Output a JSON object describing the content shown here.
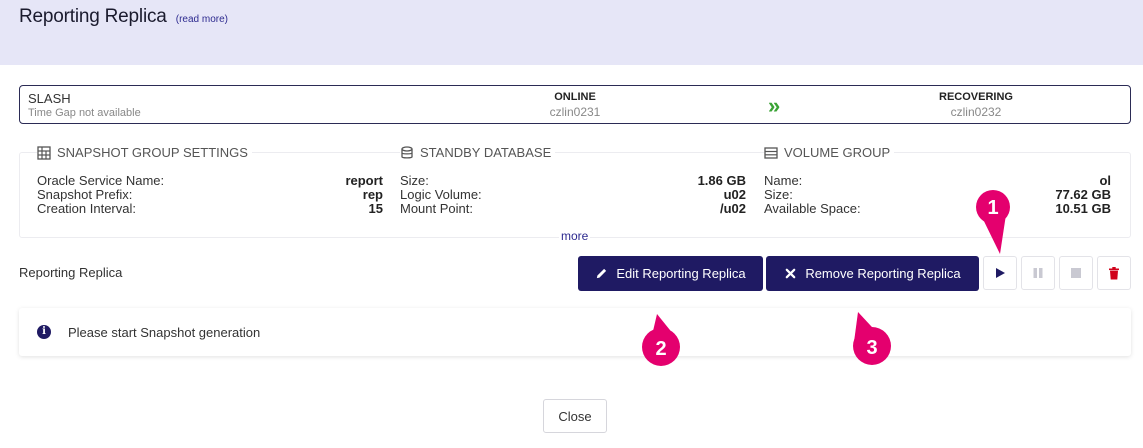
{
  "header": {
    "title": "Reporting Replica",
    "read_more": "(read more)"
  },
  "status": {
    "source_name": "SLASH",
    "time_gap": "Time Gap not available",
    "source_state": "ONLINE",
    "source_host": "czlin0231",
    "transfer_icon": "double-chevron-right-icon",
    "target_state": "RECOVERING",
    "target_host": "czlin0232"
  },
  "snapshot_group": {
    "heading": "SNAPSHOT GROUP SETTINGS",
    "icon": "table-grid-icon",
    "rows": [
      {
        "label": "Oracle Service Name:",
        "value": "report"
      },
      {
        "label": "Snapshot Prefix:",
        "value": "rep"
      },
      {
        "label": "Creation Interval:",
        "value": "15"
      }
    ]
  },
  "standby_db": {
    "heading": "STANDBY DATABASE",
    "icon": "database-icon",
    "rows": [
      {
        "label": "Size:",
        "value": "1.86 GB"
      },
      {
        "label": "Logic Volume:",
        "value": "u02"
      },
      {
        "label": "Mount Point:",
        "value": "/u02"
      }
    ]
  },
  "volume_group": {
    "heading": "VOLUME GROUP",
    "icon": "list-box-icon",
    "rows": [
      {
        "label": "Name:",
        "value": "ol"
      },
      {
        "label": "Size:",
        "value": "77.62 GB"
      },
      {
        "label": "Available Space:",
        "value": "10.51 GB"
      }
    ]
  },
  "more_link": "more",
  "replica": {
    "label": "Reporting Replica",
    "edit_label": "Edit Reporting Replica",
    "remove_label": "Remove Reporting Replica"
  },
  "info": {
    "message": "Please start Snapshot generation"
  },
  "close_label": "Close",
  "callouts": [
    "1",
    "2",
    "3"
  ],
  "colors": {
    "primary": "#1f1a63",
    "header_bg": "#e6e6f7",
    "callout": "#e4006e",
    "online_arrow": "#3aa335",
    "danger": "#d0021b"
  }
}
